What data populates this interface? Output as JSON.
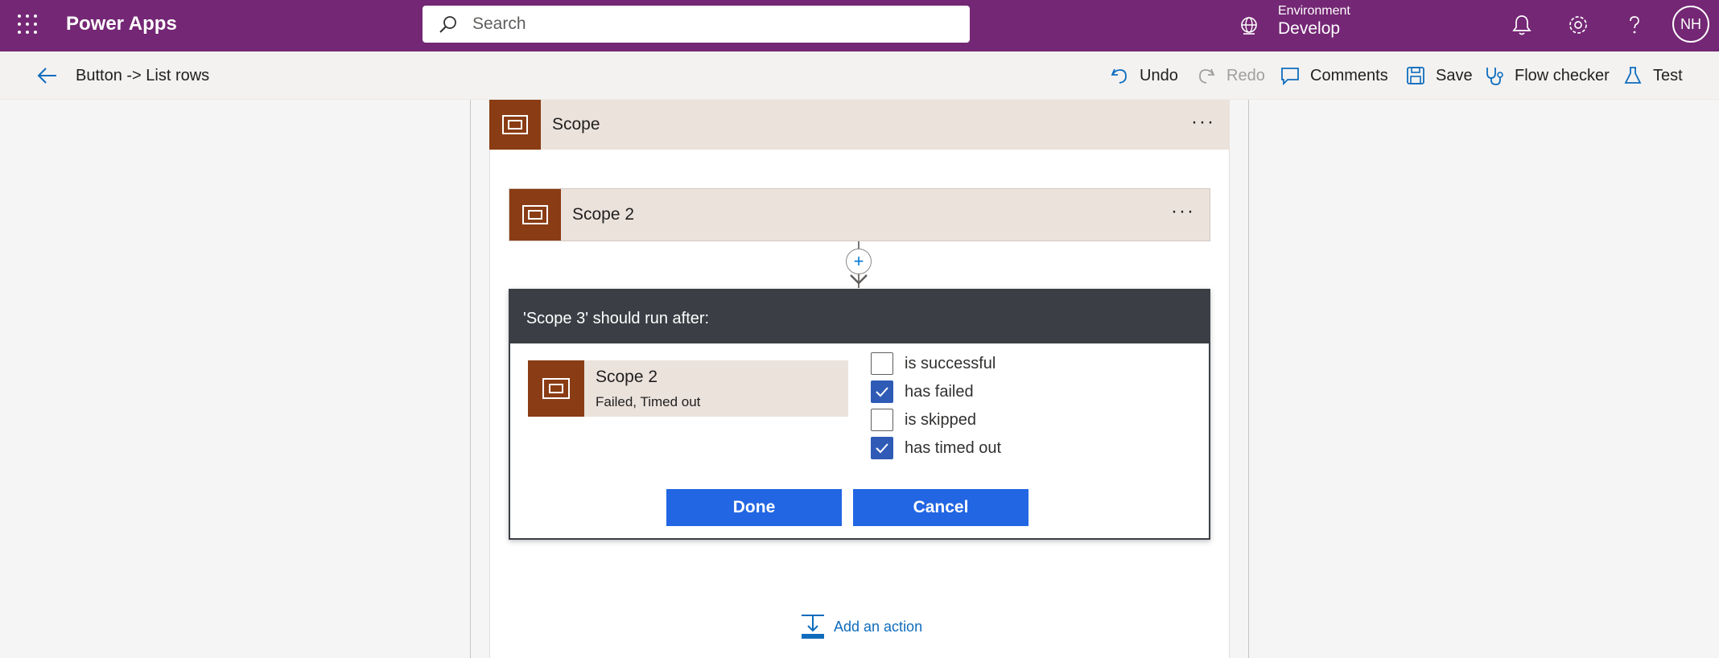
{
  "header": {
    "app_name": "Power Apps",
    "search_placeholder": "Search",
    "environment_label": "Environment",
    "environment_name": "Develop",
    "avatar_initials": "NH",
    "brand_color": "#742774"
  },
  "command_bar": {
    "flow_title": "Button -> List rows",
    "undo": "Undo",
    "redo": "Redo",
    "comments": "Comments",
    "save": "Save",
    "flow_checker": "Flow checker",
    "test": "Test"
  },
  "canvas": {
    "scope_title": "Scope",
    "scope2_title": "Scope 2",
    "add_action": "Add an action"
  },
  "dialog": {
    "title": "'Scope 3' should run after:",
    "action_name": "Scope 2",
    "action_status": "Failed, Timed out",
    "options": [
      {
        "label": "is successful",
        "checked": false
      },
      {
        "label": "has failed",
        "checked": true
      },
      {
        "label": "is skipped",
        "checked": false
      },
      {
        "label": "has timed out",
        "checked": true
      }
    ],
    "done": "Done",
    "cancel": "Cancel"
  }
}
